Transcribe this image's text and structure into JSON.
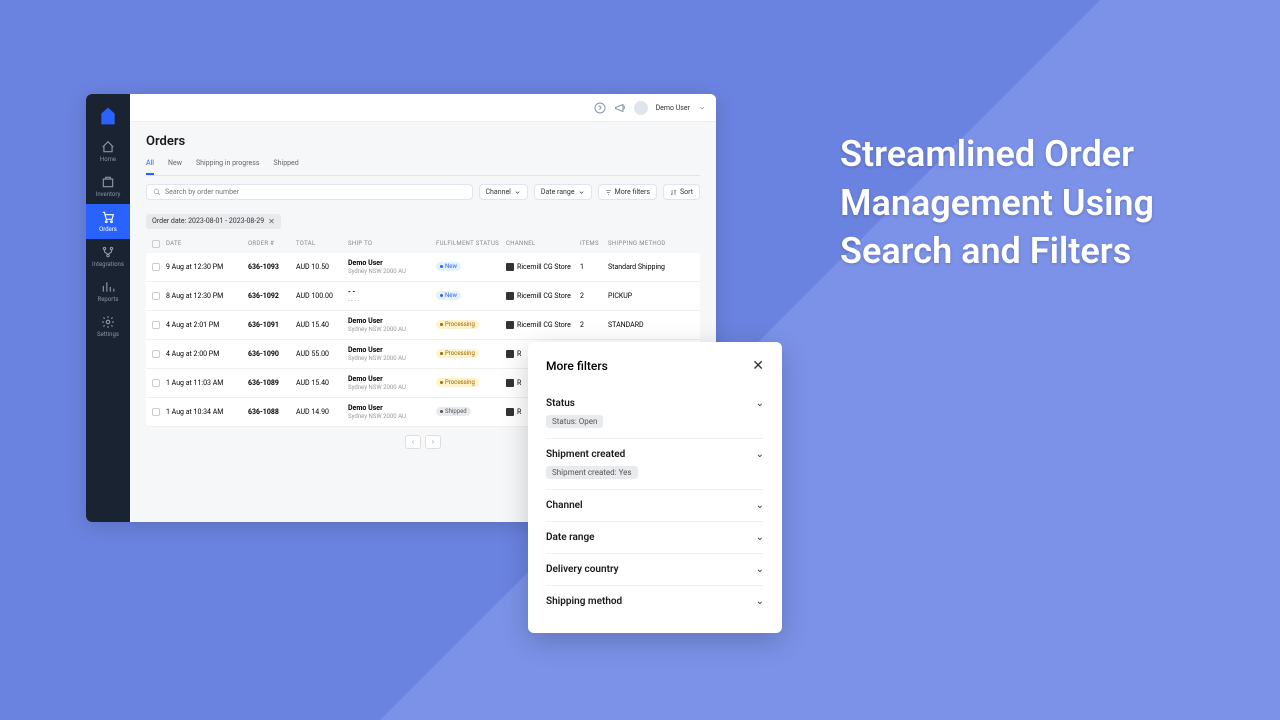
{
  "hero": "Streamlined Order Management Using Search and Filters",
  "user": {
    "name": "Demo User"
  },
  "page": {
    "title": "Orders"
  },
  "nav": [
    {
      "label": "Home"
    },
    {
      "label": "Inventory"
    },
    {
      "label": "Orders"
    },
    {
      "label": "Integrations"
    },
    {
      "label": "Reports"
    },
    {
      "label": "Settings"
    }
  ],
  "tabs": [
    {
      "label": "All"
    },
    {
      "label": "New"
    },
    {
      "label": "Shipping in progress"
    },
    {
      "label": "Shipped"
    }
  ],
  "search": {
    "placeholder": "Search by order number"
  },
  "filterButtons": {
    "channel": "Channel",
    "dateRange": "Date range",
    "moreFilters": "More filters",
    "sort": "Sort"
  },
  "activeChip": {
    "label": "Order date: 2023-08-01 - 2023-08-29"
  },
  "columns": {
    "date": "DATE",
    "order": "ORDER #",
    "total": "TOTAL",
    "ship": "SHIP TO",
    "status": "FULFILMENT STATUS",
    "channel": "CHANNEL",
    "items": "ITEMS",
    "method": "SHIPPING METHOD"
  },
  "rows": [
    {
      "date": "9 Aug at 12:30 PM",
      "order": "636-1093",
      "total": "AUD 10.50",
      "shipName": "Demo User",
      "shipAddr": "Sydney NSW 2000 AU",
      "status": "New",
      "statusClass": "new",
      "channel": "Ricemill CG Store",
      "items": "1",
      "method": "Standard Shipping"
    },
    {
      "date": "8 Aug at 12:30 PM",
      "order": "636-1092",
      "total": "AUD 100.00",
      "shipName": "- -",
      "shipAddr": "- - - -",
      "status": "New",
      "statusClass": "new",
      "channel": "Ricemill CG Store",
      "items": "2",
      "method": "PICKUP"
    },
    {
      "date": "4 Aug at 2:01 PM",
      "order": "636-1091",
      "total": "AUD 15.40",
      "shipName": "Demo User",
      "shipAddr": "Sydney NSW 2000 AU",
      "status": "Processing",
      "statusClass": "processing",
      "channel": "Ricemill CG Store",
      "items": "2",
      "method": "STANDARD"
    },
    {
      "date": "4 Aug at 2:00 PM",
      "order": "636-1090",
      "total": "AUD 55.00",
      "shipName": "Demo User",
      "shipAddr": "Sydney NSW 2000 AU",
      "status": "Processing",
      "statusClass": "processing",
      "channel": "R",
      "items": "",
      "method": ""
    },
    {
      "date": "1 Aug at 11:03 AM",
      "order": "636-1089",
      "total": "AUD 15.40",
      "shipName": "Demo User",
      "shipAddr": "Sydney NSW 2000 AU",
      "status": "Processing",
      "statusClass": "processing",
      "channel": "R",
      "items": "",
      "method": ""
    },
    {
      "date": "1 Aug at 10:34 AM",
      "order": "636-1088",
      "total": "AUD 14.90",
      "shipName": "Demo User",
      "shipAddr": "Sydney NSW 2000 AU",
      "status": "Shipped",
      "statusClass": "shipped",
      "channel": "R",
      "items": "",
      "method": ""
    }
  ],
  "filtersPanel": {
    "title": "More filters",
    "sections": [
      {
        "label": "Status",
        "tag": "Status: Open"
      },
      {
        "label": "Shipment created",
        "tag": "Shipment created: Yes"
      },
      {
        "label": "Channel"
      },
      {
        "label": "Date range"
      },
      {
        "label": "Delivery country"
      },
      {
        "label": "Shipping method"
      }
    ]
  }
}
